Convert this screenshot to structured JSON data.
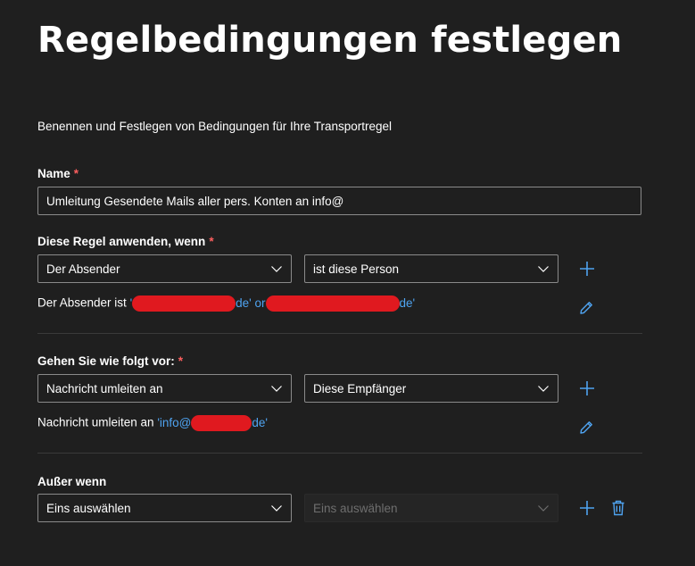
{
  "page_title": "Regelbedingungen festlegen",
  "subtitle": "Benennen und Festlegen von Bedingungen für Ihre Transportregel",
  "required_marker": "*",
  "name": {
    "label": "Name",
    "value": "Umleitung Gesendete Mails aller pers. Konten an info@"
  },
  "apply_rule": {
    "label": "Diese Regel anwenden, wenn",
    "condition_select": "Der Absender",
    "condition_value_select": "ist diese Person",
    "summary_prefix": "Der Absender ist",
    "summary_link_part1_start": "'",
    "summary_link_part1_end": "de' or",
    "summary_link_part2_end": "de'"
  },
  "actions": {
    "label": "Gehen Sie wie folgt vor:",
    "action_select": "Nachricht umleiten an",
    "action_value_select": "Diese Empfänger",
    "summary_prefix": "Nachricht umleiten an",
    "summary_link_start": "'info@",
    "summary_link_end": "de'"
  },
  "exceptions": {
    "label": "Außer wenn",
    "exception_select": "Eins auswählen",
    "exception_value_select": "Eins auswählen"
  },
  "colors": {
    "background": "#1f1f1f",
    "accent": "#4fa3f0",
    "required": "#ff5f5f",
    "redaction": "#e0191f"
  }
}
